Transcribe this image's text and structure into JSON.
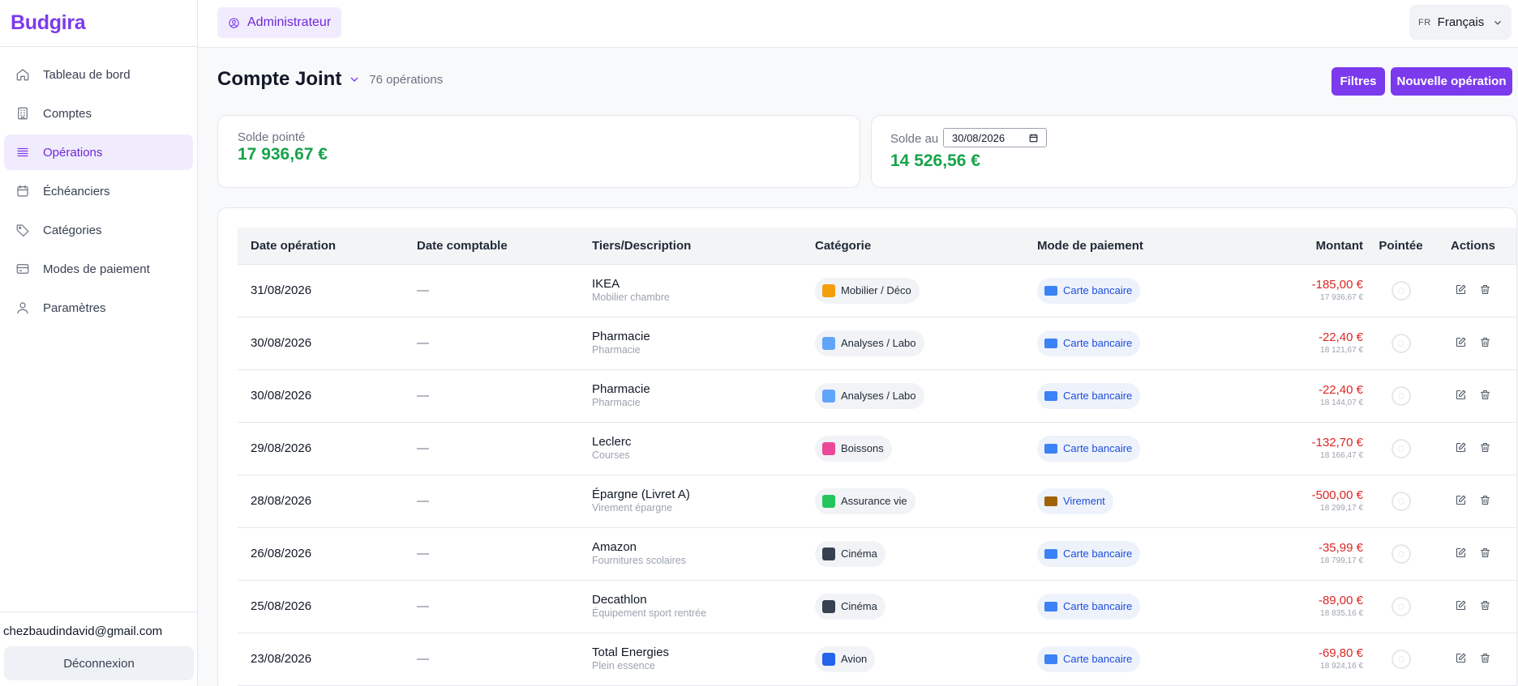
{
  "brand": "Budgira",
  "sidebar": {
    "items": [
      {
        "label": "Tableau de bord",
        "icon": "home-icon"
      },
      {
        "label": "Comptes",
        "icon": "building-icon"
      },
      {
        "label": "Opérations",
        "icon": "list-icon",
        "active": true
      },
      {
        "label": "Échéanciers",
        "icon": "calendar-icon"
      },
      {
        "label": "Catégories",
        "icon": "tag-icon"
      },
      {
        "label": "Modes de paiement",
        "icon": "card-icon"
      },
      {
        "label": "Paramètres",
        "icon": "user-icon"
      }
    ],
    "user_email": "chezbaudindavid@gmail.com",
    "logout_label": "Déconnexion"
  },
  "topbar": {
    "role": "Administrateur",
    "lang_code": "FR",
    "lang_label": "Français"
  },
  "header": {
    "title": "Compte Joint",
    "count": "76 opérations",
    "filters_label": "Filtres",
    "new_label": "Nouvelle opération"
  },
  "summary": {
    "pointed_label": "Solde pointé",
    "pointed_value": "17 936,67 €",
    "balance_label": "Solde au",
    "balance_date": "30/08/2026",
    "balance_value": "14 526,56 €"
  },
  "table": {
    "headers": [
      "Date opération",
      "Date comptable",
      "Tiers/Description",
      "Catégorie",
      "Mode de paiement",
      "Montant",
      "Pointée",
      "Actions"
    ],
    "rows": [
      {
        "date": "31/08/2026",
        "date_compta": "—",
        "tiers": "IKEA",
        "desc": "Mobilier chambre",
        "cat": "Mobilier / Déco",
        "cat_color": "#f59e0b",
        "pay": "Carte bancaire",
        "pay_color": "#3b82f6",
        "amount": "-185,00 €",
        "balance": "17 936,67 €"
      },
      {
        "date": "30/08/2026",
        "date_compta": "—",
        "tiers": "Pharmacie",
        "desc": "Pharmacie",
        "cat": "Analyses / Labo",
        "cat_color": "#60a5fa",
        "pay": "Carte bancaire",
        "pay_color": "#3b82f6",
        "amount": "-22,40 €",
        "balance": "18 121,67 €"
      },
      {
        "date": "30/08/2026",
        "date_compta": "—",
        "tiers": "Pharmacie",
        "desc": "Pharmacie",
        "cat": "Analyses / Labo",
        "cat_color": "#60a5fa",
        "pay": "Carte bancaire",
        "pay_color": "#3b82f6",
        "amount": "-22,40 €",
        "balance": "18 144,07 €"
      },
      {
        "date": "29/08/2026",
        "date_compta": "—",
        "tiers": "Leclerc",
        "desc": "Courses",
        "cat": "Boissons",
        "cat_color": "#ec4899",
        "pay": "Carte bancaire",
        "pay_color": "#3b82f6",
        "amount": "-132,70 €",
        "balance": "18 166,47 €"
      },
      {
        "date": "28/08/2026",
        "date_compta": "—",
        "tiers": "Épargne (Livret A)",
        "desc": "Virement épargne",
        "cat": "Assurance vie",
        "cat_color": "#22c55e",
        "pay": "Virement",
        "pay_color": "#a16207",
        "amount": "-500,00 €",
        "balance": "18 299,17 €"
      },
      {
        "date": "26/08/2026",
        "date_compta": "—",
        "tiers": "Amazon",
        "desc": "Fournitures scolaires",
        "cat": "Cinéma",
        "cat_color": "#374151",
        "pay": "Carte bancaire",
        "pay_color": "#3b82f6",
        "amount": "-35,99 €",
        "balance": "18 799,17 €"
      },
      {
        "date": "25/08/2026",
        "date_compta": "—",
        "tiers": "Decathlon",
        "desc": "Équipement sport rentrée",
        "cat": "Cinéma",
        "cat_color": "#374151",
        "pay": "Carte bancaire",
        "pay_color": "#3b82f6",
        "amount": "-89,00 €",
        "balance": "18 835,16 €"
      },
      {
        "date": "23/08/2026",
        "date_compta": "—",
        "tiers": "Total Energies",
        "desc": "Plein essence",
        "cat": "Avion",
        "cat_color": "#2563eb",
        "pay": "Carte bancaire",
        "pay_color": "#3b82f6",
        "amount": "-69,80 €",
        "balance": "18 924,16 €"
      }
    ]
  },
  "colors": {
    "accent": "#7c3aed",
    "positive": "#16a34a",
    "negative": "#dc2626"
  }
}
